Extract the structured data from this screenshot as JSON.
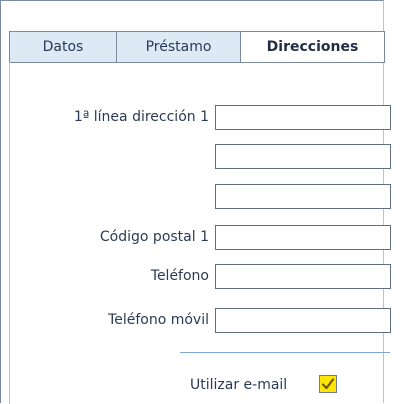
{
  "tabs": [
    {
      "label": "Datos",
      "active": false
    },
    {
      "label": "Préstamo",
      "active": false
    },
    {
      "label": "Direcciones",
      "active": true
    }
  ],
  "form": {
    "address_line1_label": "1ª línea dirección 1",
    "address_line1_value": "",
    "address_line2_value": "",
    "address_line3_value": "",
    "postal_code_label": "Código postal 1",
    "postal_code_value": "",
    "phone_label": "Teléfono",
    "phone_value": "",
    "mobile_label": "Teléfono móvil",
    "mobile_value": "",
    "use_email_label": "Utilizar e-mail",
    "use_email_checked": true
  },
  "colors": {
    "tab_inactive_bg": "#dde9f5",
    "checkbox_bg": "#ffe600",
    "divider": "#7fa7d1"
  }
}
